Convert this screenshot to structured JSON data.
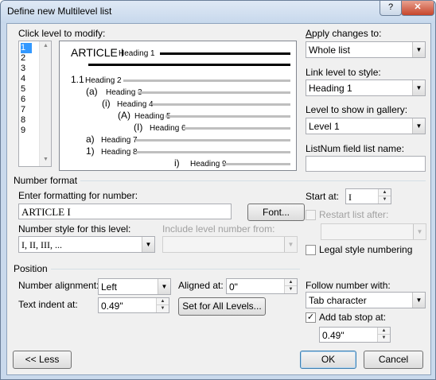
{
  "window": {
    "title": "Define new Multilevel list",
    "help_glyph": "?",
    "close_glyph": "✕"
  },
  "level_list": {
    "label": "Click level to modify:",
    "items": [
      "1",
      "2",
      "3",
      "4",
      "5",
      "6",
      "7",
      "8",
      "9"
    ],
    "selected": "1"
  },
  "preview": {
    "rows": [
      {
        "num": "ARTICLE I",
        "heading": "Heading 1"
      },
      {
        "num": "1.1",
        "heading": "Heading 2"
      },
      {
        "num": "(a)",
        "heading": "Heading 3"
      },
      {
        "num": "(i)",
        "heading": "Heading 4"
      },
      {
        "num": "(A)",
        "heading": "Heading 5"
      },
      {
        "num": "(I)",
        "heading": "Heading 6"
      },
      {
        "num": "a)",
        "heading": "Heading 7"
      },
      {
        "num": "1)",
        "heading": "Heading 8"
      },
      {
        "num": "i)",
        "heading": "Heading 9"
      }
    ]
  },
  "right_panel": {
    "apply_label": "Apply changes to:",
    "apply_value": "Whole list",
    "link_label": "Link level to style:",
    "link_value": "Heading 1",
    "gallery_label": "Level to show in gallery:",
    "gallery_value": "Level 1",
    "listnum_label": "ListNum field list name:",
    "listnum_value": ""
  },
  "number_format": {
    "group_title": "Number format",
    "formatting_label": "Enter formatting for number:",
    "formatting_value": "ARTICLE I",
    "font_button": "Font...",
    "style_label": "Number style for this level:",
    "style_value": "I, II, III, ...",
    "include_label": "Include level number from:",
    "include_value": "",
    "start_at_label": "Start at:",
    "start_at_value": "I",
    "restart_label": "Restart list after:",
    "restart_checked": false,
    "restart_value": "",
    "legal_label": "Legal style numbering",
    "legal_checked": false
  },
  "position": {
    "group_title": "Position",
    "alignment_label": "Number alignment:",
    "alignment_value": "Left",
    "aligned_at_label": "Aligned at:",
    "aligned_at_value": "0\"",
    "indent_label": "Text indent at:",
    "indent_value": "0.49\"",
    "set_all_button": "Set for All Levels...",
    "follow_label": "Follow number with:",
    "follow_value": "Tab character",
    "tab_stop_label": "Add tab stop at:",
    "tab_stop_checked": true,
    "tab_stop_value": "0.49\""
  },
  "footer": {
    "less_button": "<< Less",
    "ok_button": "OK",
    "cancel_button": "Cancel"
  }
}
